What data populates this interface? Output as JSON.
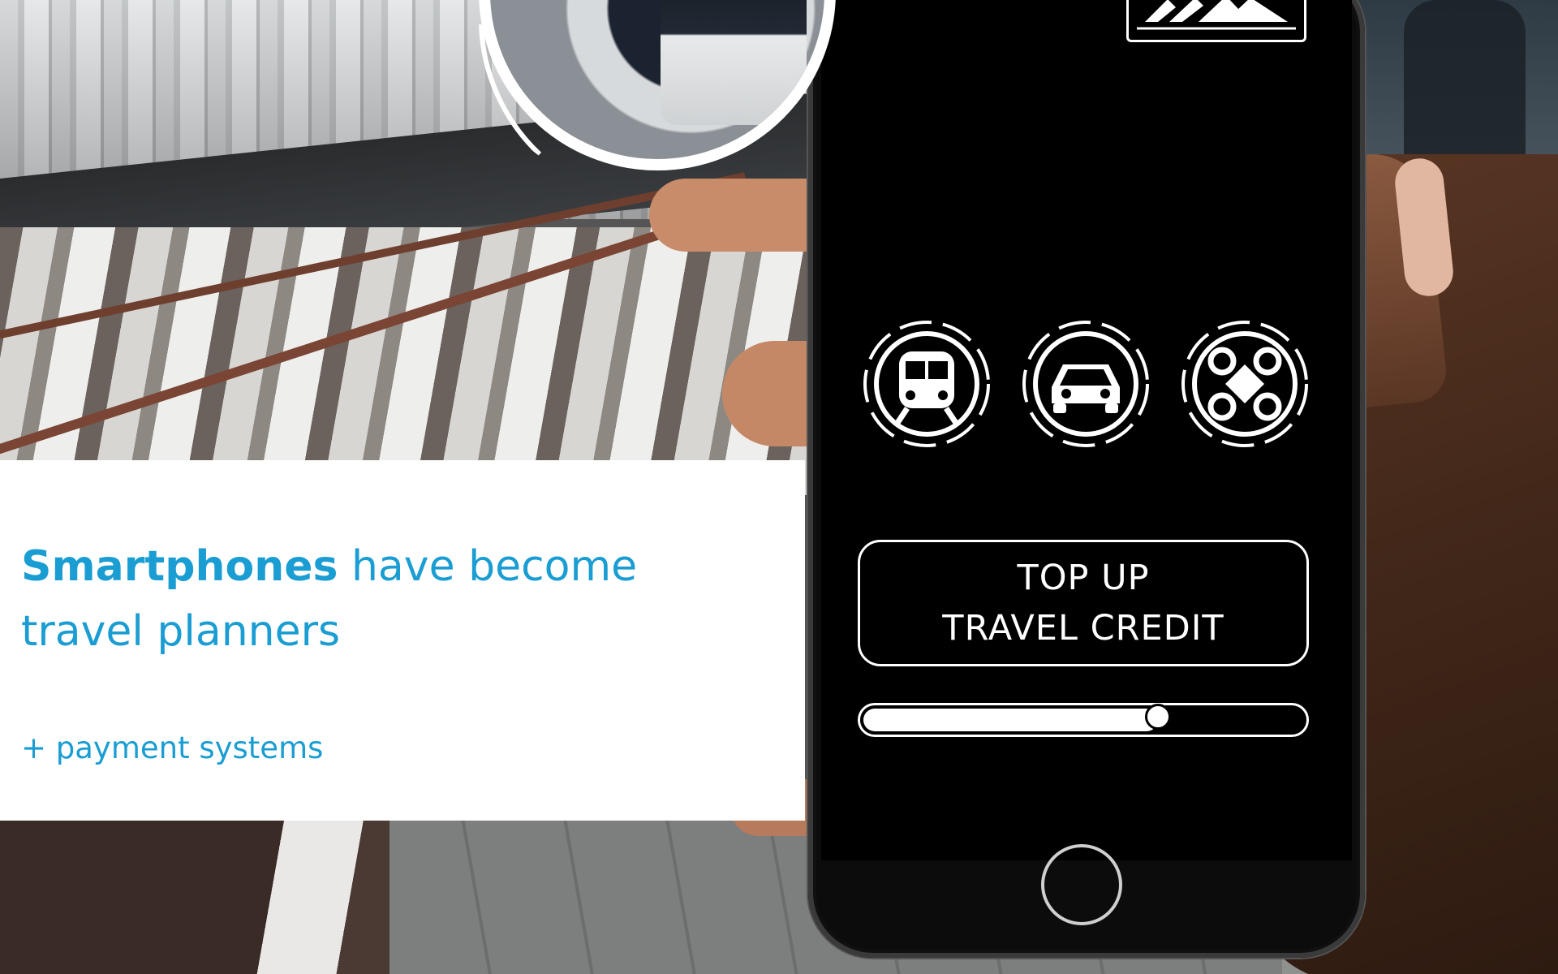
{
  "headline": {
    "bold": "Smartphones",
    "rest_line1": " have become",
    "line2": "travel planners"
  },
  "subtext": "+ payment systems",
  "phone": {
    "topup_line1": "TOP UP",
    "topup_line2": "TRAVEL CREDIT",
    "slider_level": 0.67,
    "modes": [
      "train-icon",
      "car-icon",
      "drone-icon"
    ]
  },
  "colors": {
    "accent": "#1a9dd2",
    "screen": "#000000",
    "panel": "#ffffff"
  }
}
